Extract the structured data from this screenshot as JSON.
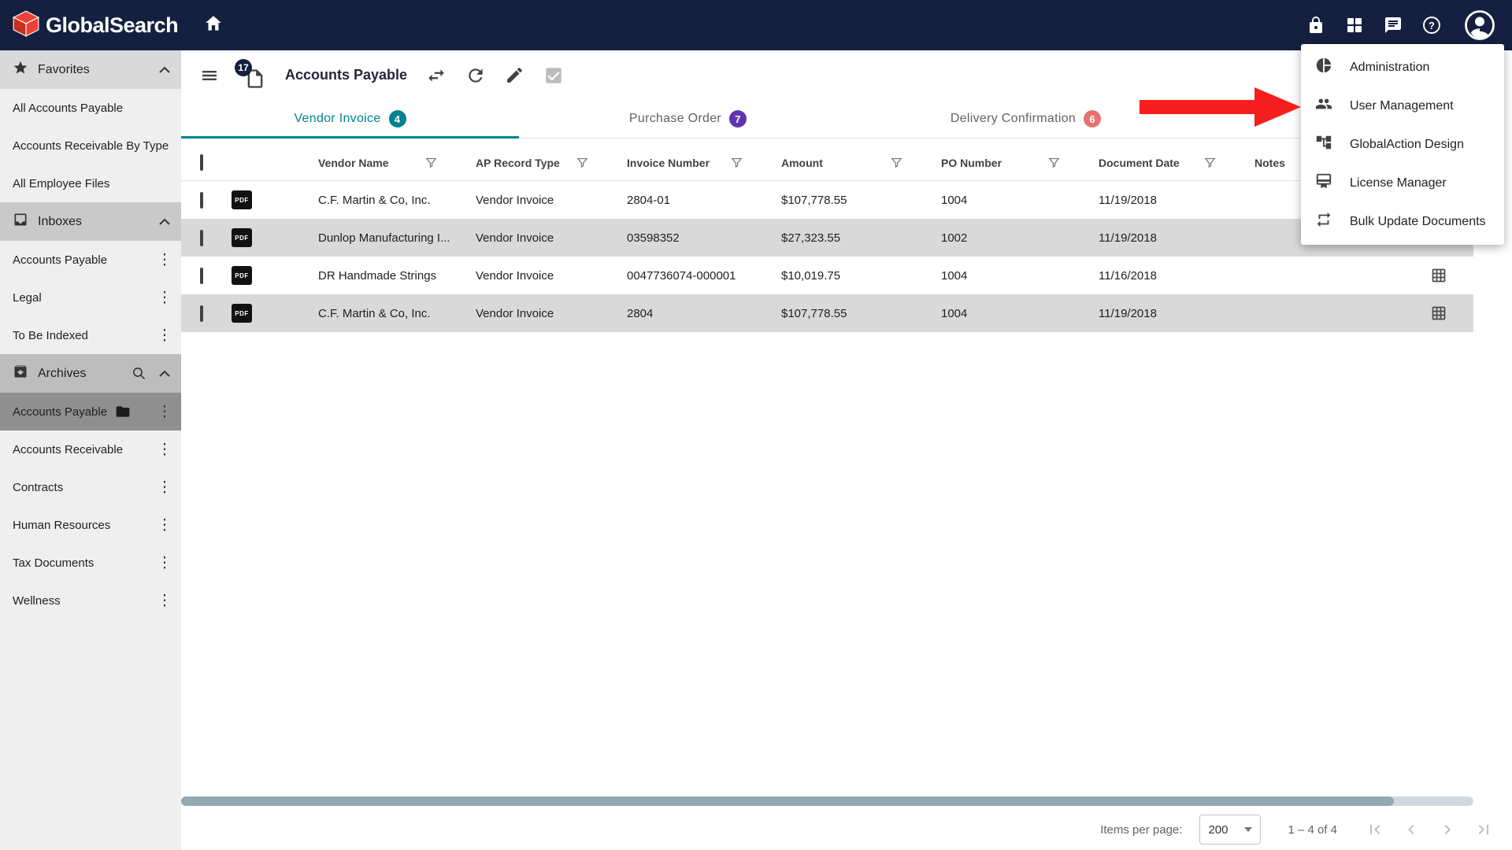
{
  "topbar": {
    "brand": "GlobalSearch"
  },
  "sidebar": {
    "favorites": {
      "label": "Favorites",
      "items": [
        "All Accounts Payable",
        "Accounts Receivable By Type",
        "All Employee Files"
      ]
    },
    "inboxes": {
      "label": "Inboxes",
      "items": [
        "Accounts Payable",
        "Legal",
        "To Be Indexed"
      ]
    },
    "archives": {
      "label": "Archives",
      "items": [
        "Accounts Payable",
        "Accounts Receivable",
        "Contracts",
        "Human Resources",
        "Tax Documents",
        "Wellness"
      ],
      "selected": "Accounts Payable"
    }
  },
  "toolbar": {
    "title": "Accounts Payable",
    "badge": "17"
  },
  "tabs": [
    {
      "label": "Vendor Invoice",
      "count": "4"
    },
    {
      "label": "Purchase Order",
      "count": "7"
    },
    {
      "label": "Delivery Confirmation",
      "count": "6"
    }
  ],
  "table": {
    "columns": {
      "vendor": "Vendor Name",
      "type": "AP Record Type",
      "invoice": "Invoice Number",
      "amount": "Amount",
      "po": "PO Number",
      "date": "Document Date",
      "notes": "Notes"
    },
    "rows": [
      {
        "vendor": "C.F. Martin & Co, Inc.",
        "type": "Vendor Invoice",
        "invoice": "2804-01",
        "amount": "$107,778.55",
        "po": "1004",
        "date": "11/19/2018"
      },
      {
        "vendor": "Dunlop Manufacturing I...",
        "type": "Vendor Invoice",
        "invoice": "03598352",
        "amount": "$27,323.55",
        "po": "1002",
        "date": "11/19/2018"
      },
      {
        "vendor": "DR Handmade Strings",
        "type": "Vendor Invoice",
        "invoice": "0047736074-000001",
        "amount": "$10,019.75",
        "po": "1004",
        "date": "11/16/2018"
      },
      {
        "vendor": "C.F. Martin & Co, Inc.",
        "type": "Vendor Invoice",
        "invoice": "2804",
        "amount": "$107,778.55",
        "po": "1004",
        "date": "11/19/2018"
      }
    ],
    "pdf_chip_label": "PDF"
  },
  "footer": {
    "items_per_page_label": "Items per page:",
    "page_size": "200",
    "range": "1 – 4 of 4"
  },
  "menu": {
    "items": [
      {
        "label": "Administration"
      },
      {
        "label": "User Management"
      },
      {
        "label": "GlobalAction Design"
      },
      {
        "label": "License Manager"
      },
      {
        "label": "Bulk Update Documents"
      }
    ]
  },
  "colors": {
    "navy": "#152040",
    "teal": "#00838f",
    "purple": "#5e35b1",
    "pink": "#e57373",
    "brand_red": "#ef4136",
    "arrow_red": "#f61f1f"
  }
}
